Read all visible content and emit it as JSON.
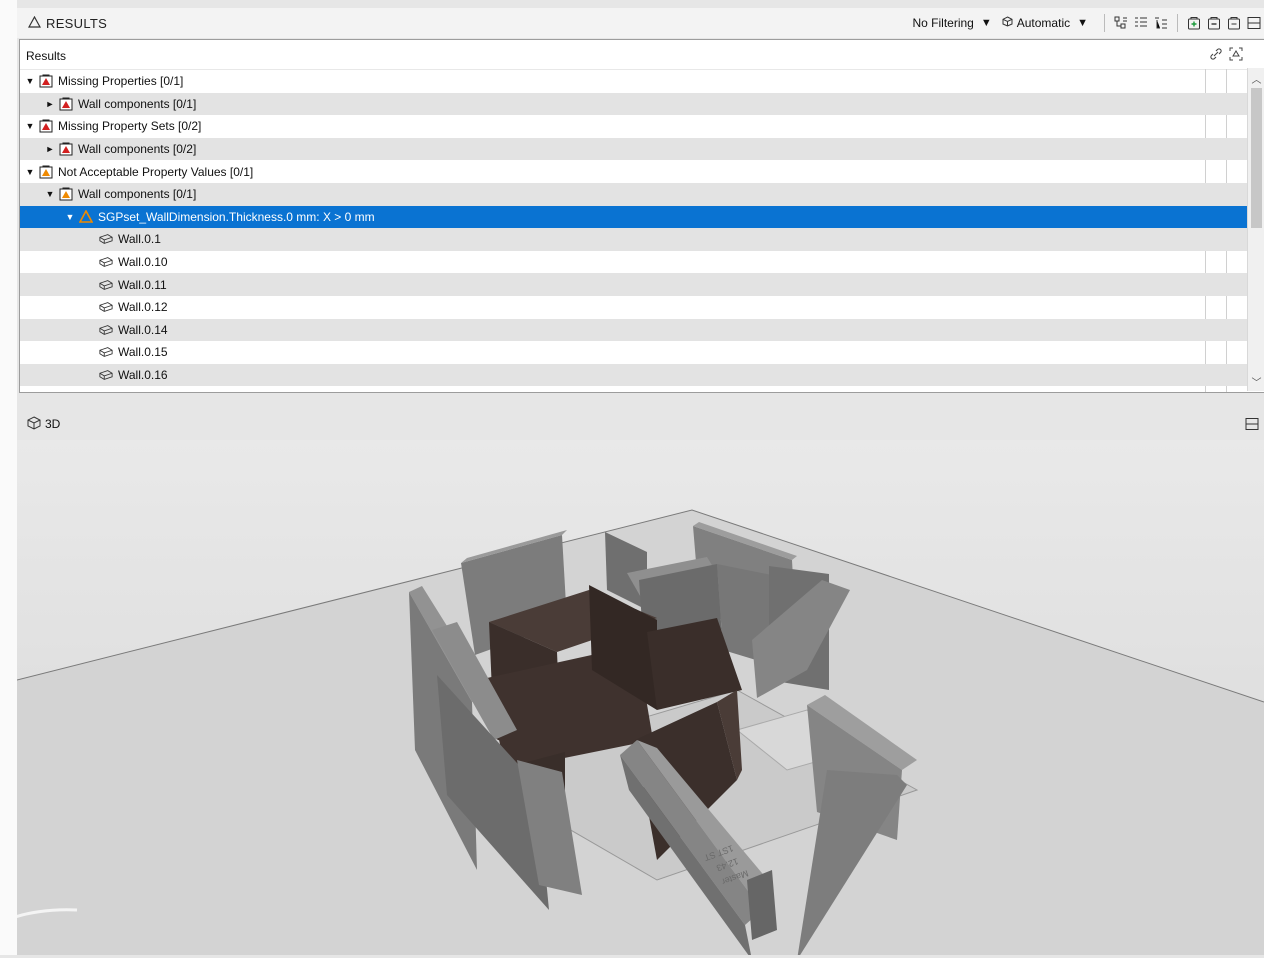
{
  "results": {
    "title": "RESULTS",
    "filter_label": "No Filtering",
    "mode_label": "Automatic",
    "column_header": "Results"
  },
  "tree": [
    {
      "label": "Missing Properties [0/1]",
      "level": 0,
      "expander": "open",
      "icon": "error-folder-icon"
    },
    {
      "label": "Wall components [0/1]",
      "level": 1,
      "expander": "closed",
      "icon": "error-folder-icon"
    },
    {
      "label": "Missing Property Sets [0/2]",
      "level": 0,
      "expander": "open",
      "icon": "error-folder-icon"
    },
    {
      "label": "Wall components [0/2]",
      "level": 1,
      "expander": "closed",
      "icon": "error-folder-icon"
    },
    {
      "label": "Not Acceptable Property Values [0/1]",
      "level": 0,
      "expander": "open",
      "icon": "warning-folder-icon"
    },
    {
      "label": "Wall components [0/1]",
      "level": 1,
      "expander": "open",
      "icon": "warning-folder-icon"
    },
    {
      "label": "SGPset_WallDimension.Thickness.0 mm:  X > 0 mm",
      "level": 2,
      "expander": "open",
      "icon": "warning-icon",
      "selected": true
    },
    {
      "label": "Wall.0.1",
      "level": 3,
      "expander": "none",
      "icon": "wall-component-icon"
    },
    {
      "label": "Wall.0.10",
      "level": 3,
      "expander": "none",
      "icon": "wall-component-icon"
    },
    {
      "label": "Wall.0.11",
      "level": 3,
      "expander": "none",
      "icon": "wall-component-icon"
    },
    {
      "label": "Wall.0.12",
      "level": 3,
      "expander": "none",
      "icon": "wall-component-icon"
    },
    {
      "label": "Wall.0.14",
      "level": 3,
      "expander": "none",
      "icon": "wall-component-icon"
    },
    {
      "label": "Wall.0.15",
      "level": 3,
      "expander": "none",
      "icon": "wall-component-icon"
    },
    {
      "label": "Wall.0.16",
      "level": 3,
      "expander": "none",
      "icon": "wall-component-icon"
    }
  ],
  "view3d": {
    "title": "3D"
  },
  "colors": {
    "selection": "#0a73d2",
    "error_red": "#d32020",
    "warning_orange": "#f08a00",
    "wall_gray": "#6d6d6d",
    "wall_dark": "#3b2f2b"
  }
}
